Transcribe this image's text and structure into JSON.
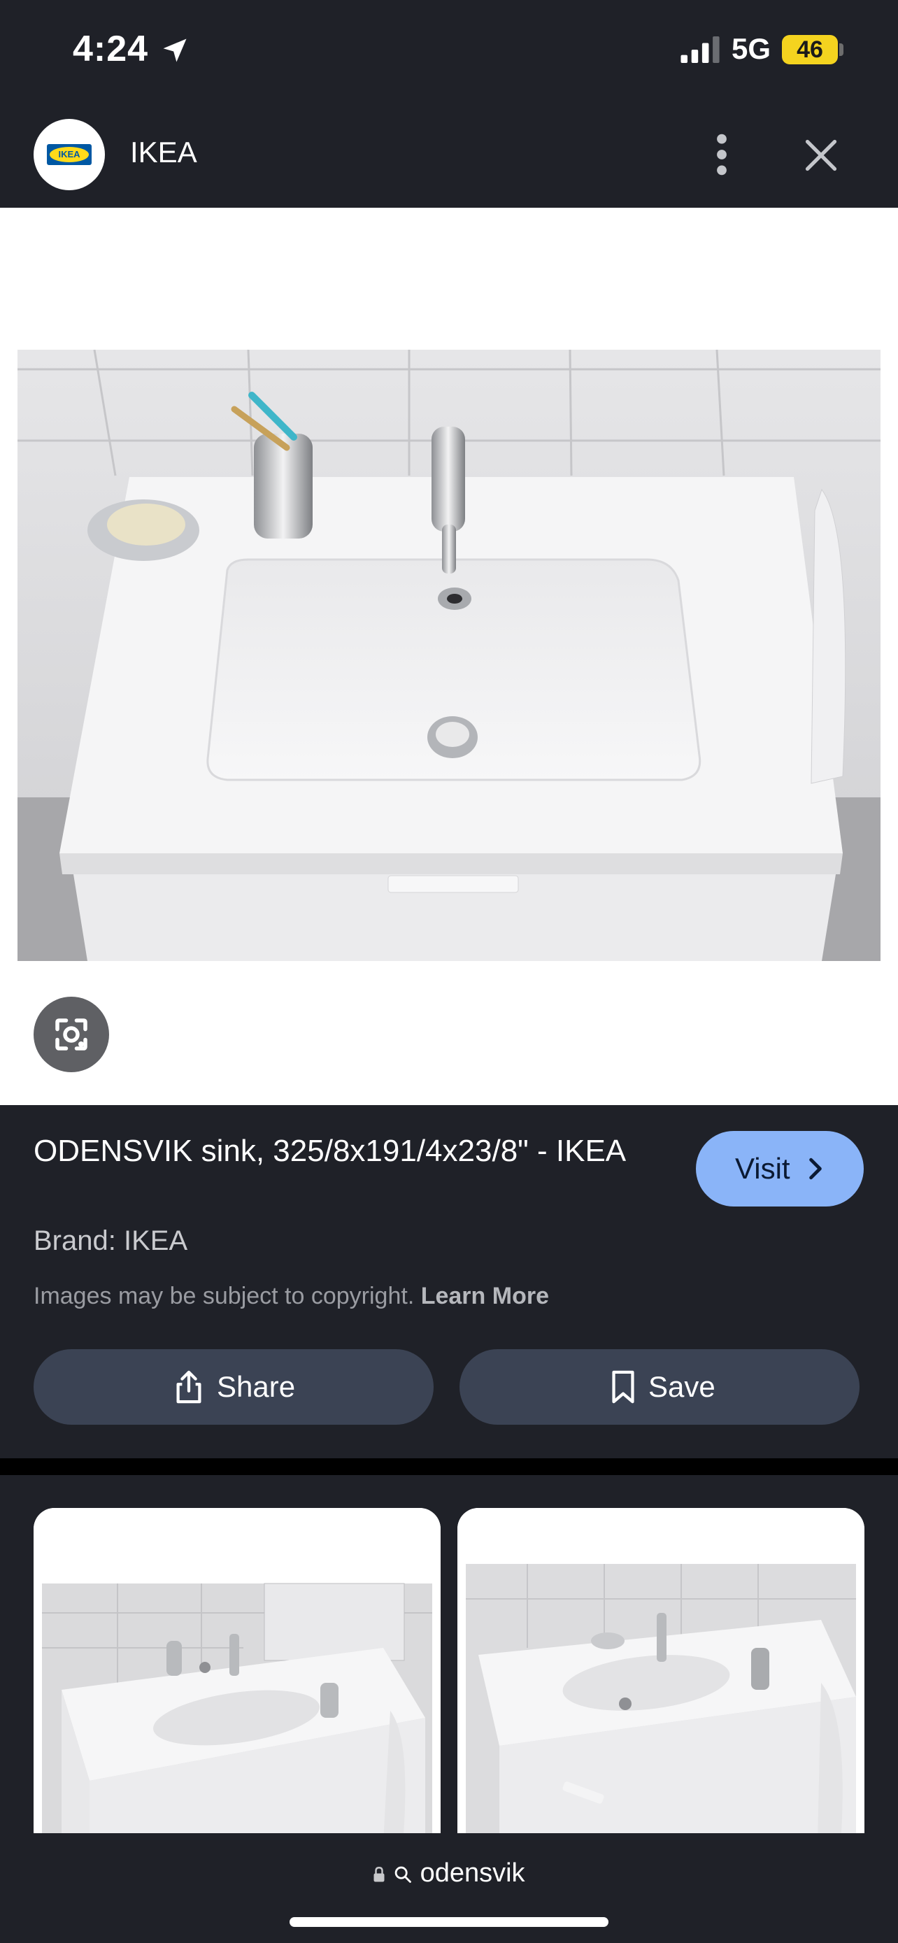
{
  "status_bar": {
    "time": "4:24",
    "network": "5G",
    "battery": "46"
  },
  "header": {
    "site_name": "IKEA",
    "logo_text": "IKEA"
  },
  "product": {
    "title": "ODENSVIK sink, 325/8x191/4x23/8\" - IKEA",
    "brand": "Brand: IKEA",
    "copyright": "Images may be subject to copyright.",
    "learn_more": "Learn More",
    "visit_label": "Visit"
  },
  "actions": {
    "share_label": "Share",
    "save_label": "Save"
  },
  "bottom_bar": {
    "query": "odensvik"
  },
  "colors": {
    "accent": "#8ab4f8",
    "panel": "#1f2128",
    "button": "#3b4354",
    "battery": "#f4d31f"
  }
}
